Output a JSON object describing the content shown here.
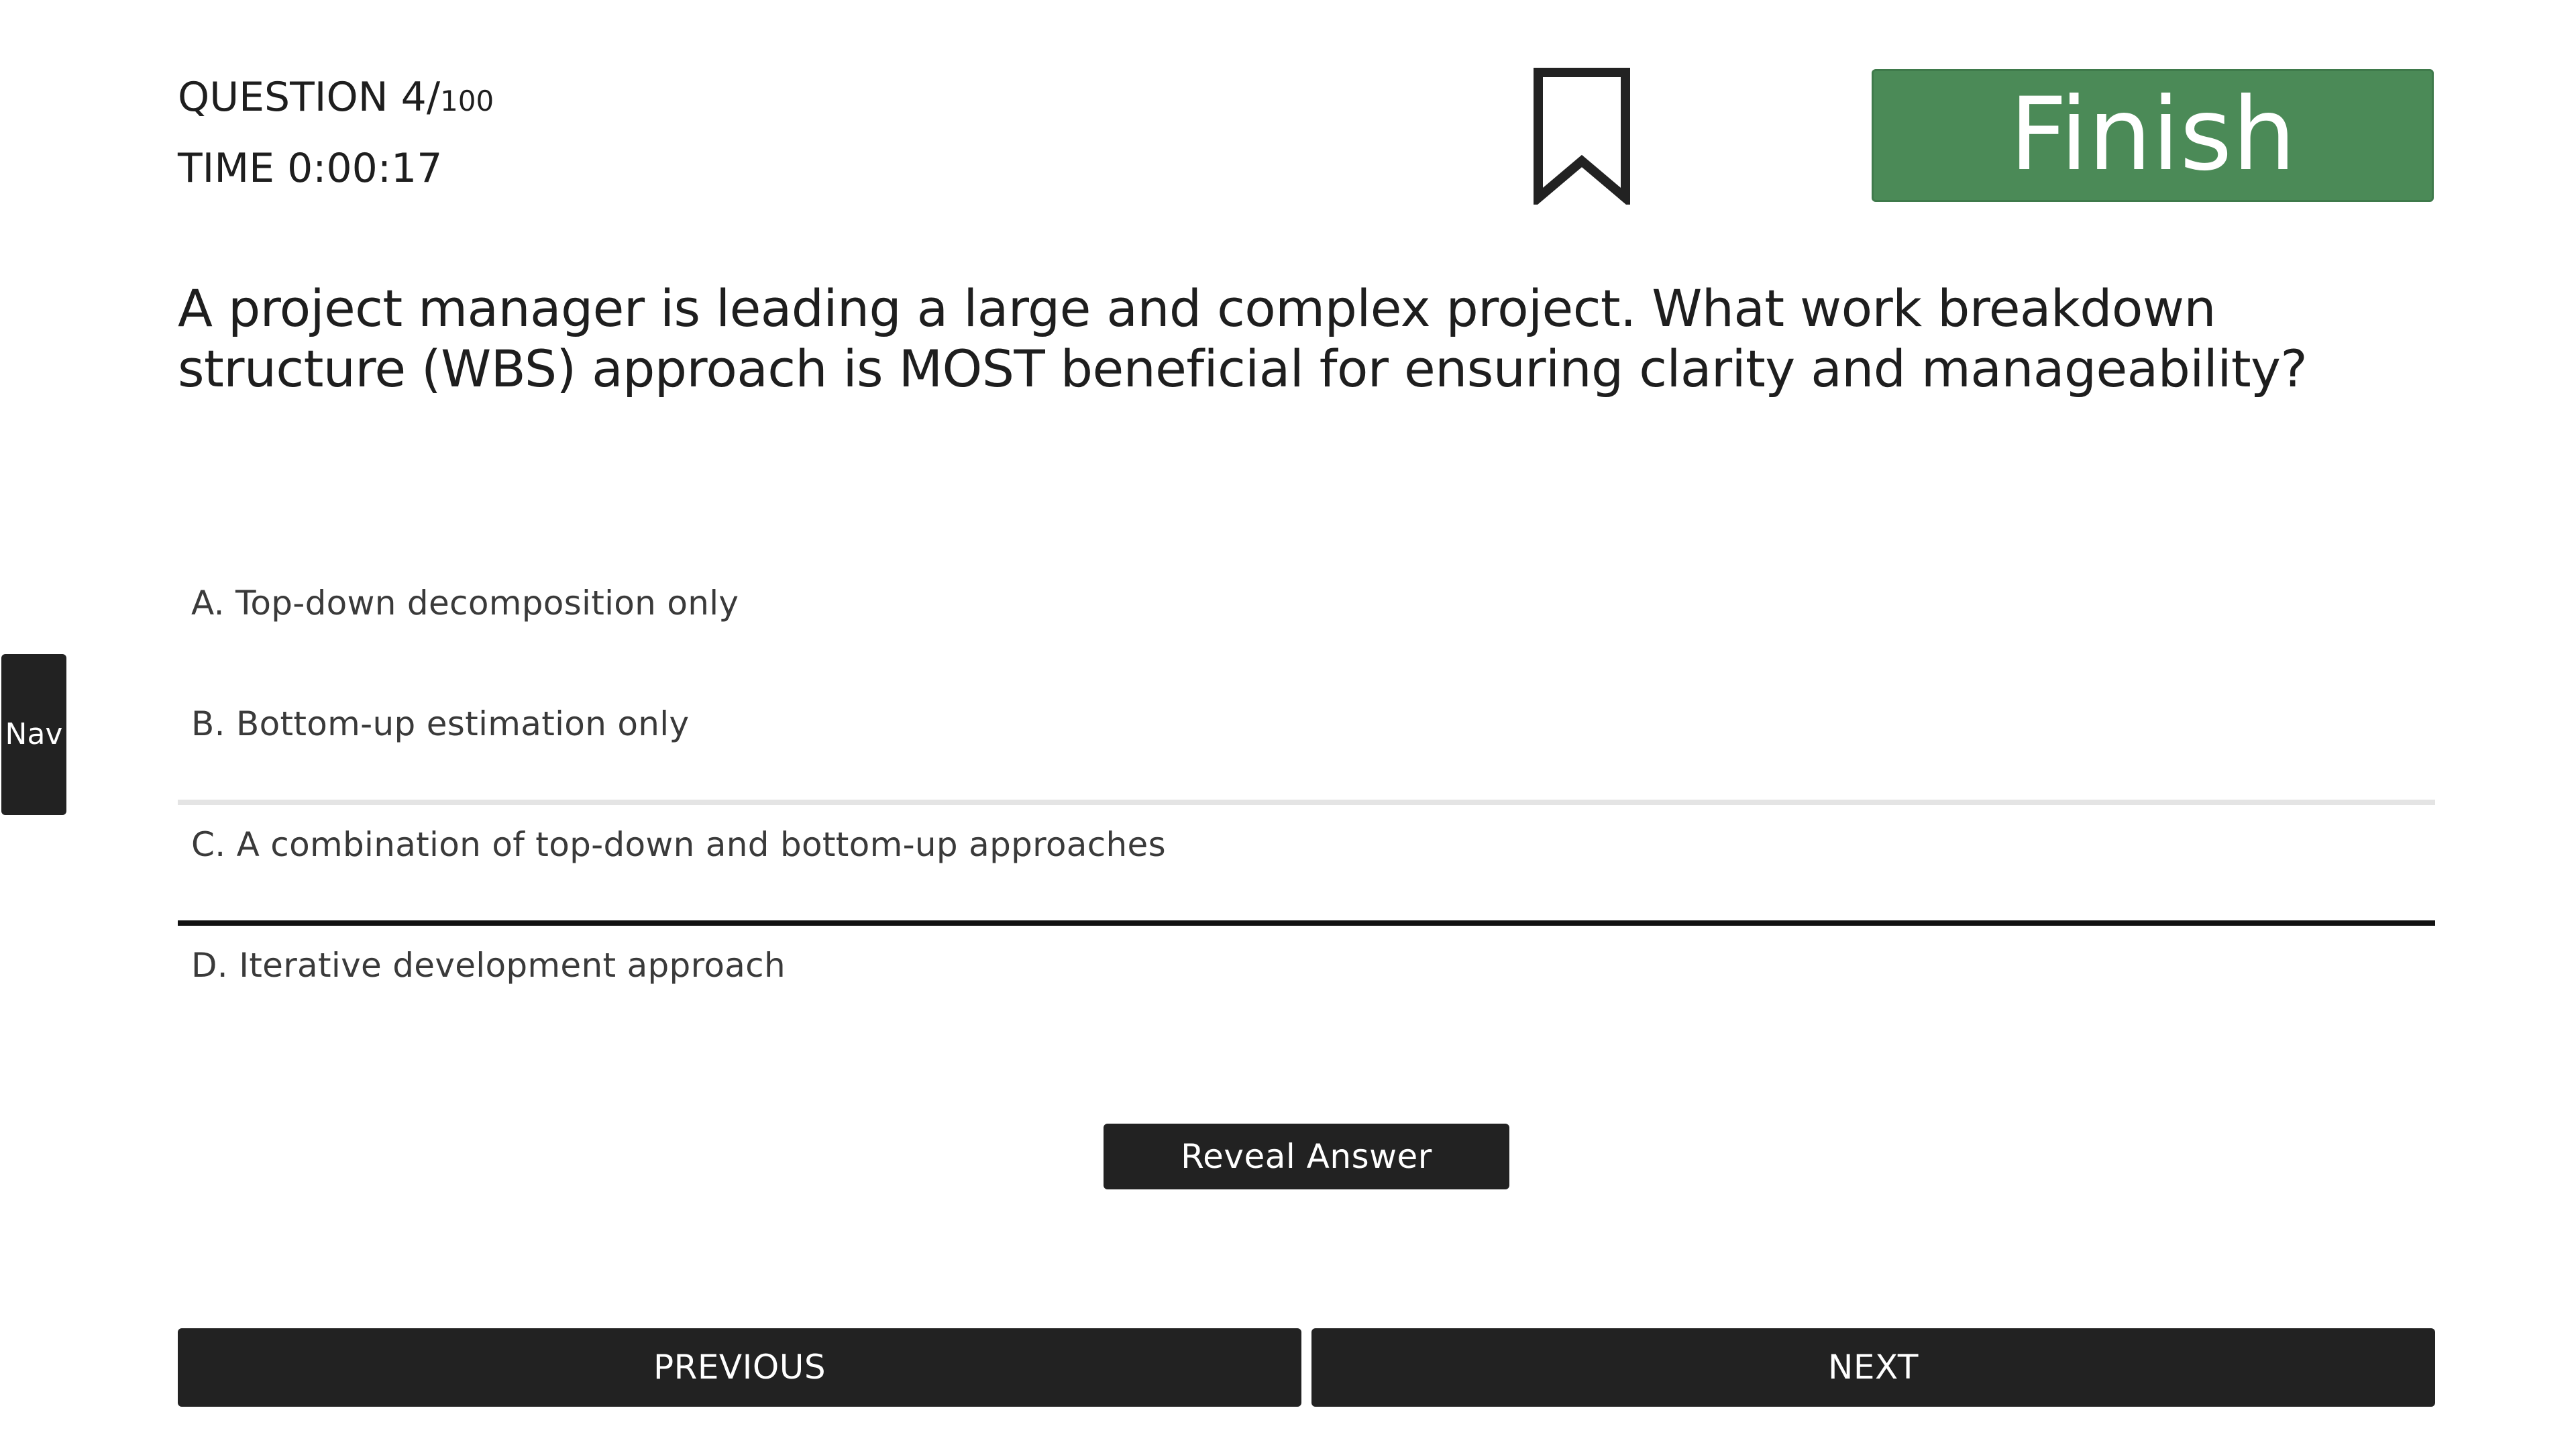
{
  "header": {
    "question_prefix": "QUESTION 4/",
    "question_total": "100",
    "time_label": "TIME 0:00:17",
    "finish_label": "Finish"
  },
  "question": {
    "text": "A project manager is leading a large and complex project. What work breakdown structure (WBS) approach is MOST beneficial for ensuring clarity and manageability?"
  },
  "options": [
    {
      "label": "A. Top-down decomposition only"
    },
    {
      "label": "B. Bottom-up estimation only"
    },
    {
      "label": "C. A combination of top-down and bottom-up approaches"
    },
    {
      "label": "D. Iterative development approach"
    }
  ],
  "sidebar": {
    "nav_label": "Nav"
  },
  "actions": {
    "reveal_label": "Reveal Answer",
    "previous_label": "PREVIOUS",
    "next_label": "NEXT"
  },
  "icons": {
    "bookmark": "bookmark-icon"
  },
  "colors": {
    "finish": "#4b8a57",
    "button_dark": "#222222",
    "selected_underline": "#111111",
    "hover_underline": "#e4e4e4"
  }
}
